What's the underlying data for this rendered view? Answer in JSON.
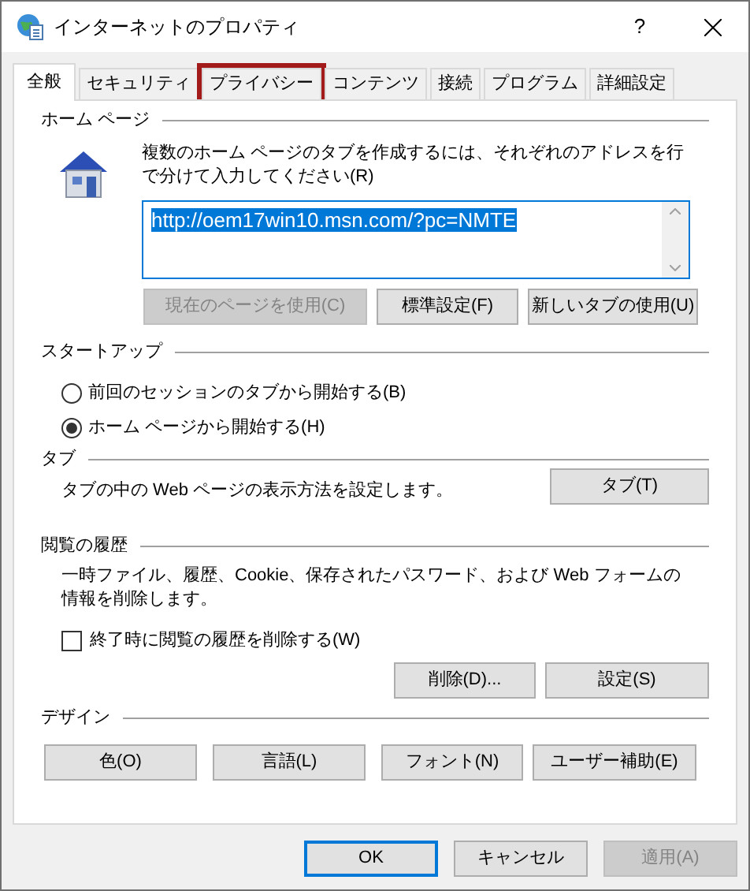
{
  "window": {
    "title": "インターネットのプロパティ",
    "help": "?"
  },
  "tabs": [
    {
      "label": "全般",
      "selected": true,
      "highlighted": false
    },
    {
      "label": "セキュリティ",
      "selected": false,
      "highlighted": false
    },
    {
      "label": "プライバシー",
      "selected": false,
      "highlighted": true
    },
    {
      "label": "コンテンツ",
      "selected": false,
      "highlighted": false
    },
    {
      "label": "接続",
      "selected": false,
      "highlighted": false
    },
    {
      "label": "プログラム",
      "selected": false,
      "highlighted": false
    },
    {
      "label": "詳細設定",
      "selected": false,
      "highlighted": false
    }
  ],
  "home_page": {
    "heading": "ホーム ページ",
    "description": "複数のホーム ページのタブを作成するには、それぞれのアドレスを行で分けて入力してください(R)",
    "address": "http://oem17win10.msn.com/?pc=NMTE",
    "address_selected": true,
    "buttons": [
      {
        "label": "現在のページを使用(C)",
        "disabled": true
      },
      {
        "label": "標準設定(F)",
        "disabled": false
      },
      {
        "label": "新しいタブの使用(U)",
        "disabled": false
      }
    ]
  },
  "startup": {
    "heading": "スタートアップ",
    "options": [
      {
        "label": "前回のセッションのタブから開始する(B)",
        "selected": false
      },
      {
        "label": "ホーム ページから開始する(H)",
        "selected": true
      }
    ]
  },
  "tab_settings": {
    "heading": "タブ",
    "description": "タブの中の Web ページの表示方法を設定します。",
    "button": "タブ(T)"
  },
  "history": {
    "heading": "閲覧の履歴",
    "description": "一時ファイル、履歴、Cookie、保存されたパスワード、および Web フォームの情報を削除します。",
    "checkbox": {
      "label": "終了時に閲覧の履歴を削除する(W)",
      "checked": false
    },
    "buttons": [
      {
        "label": "削除(D)...",
        "disabled": false
      },
      {
        "label": "設定(S)",
        "disabled": false
      }
    ]
  },
  "design": {
    "heading": "デザイン",
    "buttons": [
      {
        "label": "色(O)",
        "disabled": false
      },
      {
        "label": "言語(L)",
        "disabled": false
      },
      {
        "label": "フォント(N)",
        "disabled": false
      },
      {
        "label": "ユーザー補助(E)",
        "disabled": false
      }
    ]
  },
  "footer_buttons": [
    {
      "label": "OK",
      "disabled": false,
      "default": true
    },
    {
      "label": "キャンセル",
      "disabled": false,
      "default": false
    },
    {
      "label": "適用(A)",
      "disabled": true,
      "default": false
    }
  ]
}
